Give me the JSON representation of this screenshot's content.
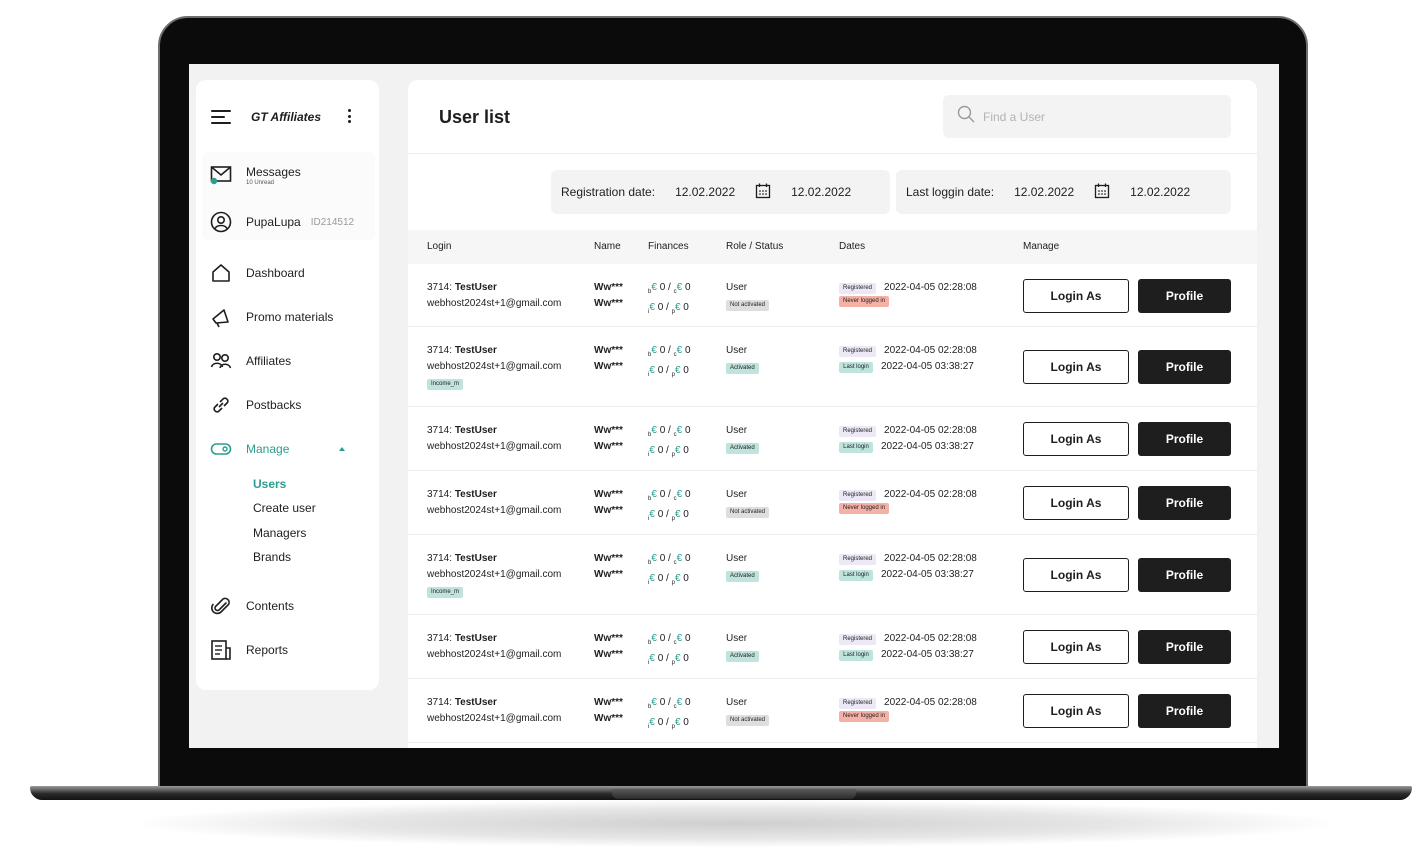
{
  "app": {
    "brand": "GT Affiliates"
  },
  "sidebar": {
    "messages": {
      "label": "Messages",
      "sub": "10 Unread"
    },
    "account": {
      "name": "PupaLupa",
      "id": "ID214512"
    },
    "nav": [
      {
        "label": "Dashboard",
        "icon": "home-icon"
      },
      {
        "label": "Promo materials",
        "icon": "megaphone-icon"
      },
      {
        "label": "Affiliates",
        "icon": "users-icon"
      },
      {
        "label": "Postbacks",
        "icon": "link-icon"
      },
      {
        "label": "Manage",
        "icon": "toggle-icon"
      },
      {
        "label": "Contents",
        "icon": "paperclip-icon"
      },
      {
        "label": "Reports",
        "icon": "report-icon"
      }
    ],
    "manage_sub": [
      "Users",
      "Create user",
      "Managers",
      "Brands"
    ]
  },
  "main": {
    "title": "User list",
    "search": {
      "placeholder": "Find a User"
    },
    "filters": {
      "registration": {
        "label": "Registration date:",
        "from": "12.02.2022",
        "to": "12.02.2022"
      },
      "last_login": {
        "label": "Last loggin date:",
        "from": "12.02.2022",
        "to": "12.02.2022"
      }
    },
    "columns": [
      "Login",
      "Name",
      "Finances",
      "Role / Status",
      "Dates",
      "Manage"
    ],
    "rows": [
      {
        "id": "3714: ",
        "login": "TestUser",
        "email": "webhost2024st+1@gmail.com",
        "tag": "",
        "name1": "Ww***",
        "name2": "Ww***",
        "role": "User",
        "status": "Not activated",
        "registered": "2022-04-05 02:28:08",
        "last": "Never logged in",
        "last_date": ""
      },
      {
        "id": "3714: ",
        "login": "TestUser",
        "email": "webhost2024st+1@gmail.com",
        "tag": "Income_m",
        "name1": "Ww***",
        "name2": "Ww***",
        "role": "User",
        "status": "Activated",
        "registered": "2022-04-05 02:28:08",
        "last": "Last login",
        "last_date": "2022-04-05 03:38:27"
      },
      {
        "id": "3714: ",
        "login": "TestUser",
        "email": "webhost2024st+1@gmail.com",
        "tag": "",
        "name1": "Ww***",
        "name2": "Ww***",
        "role": "User",
        "status": "Activated",
        "registered": "2022-04-05 02:28:08",
        "last": "Last login",
        "last_date": "2022-04-05 03:38:27"
      },
      {
        "id": "3714: ",
        "login": "TestUser",
        "email": "webhost2024st+1@gmail.com",
        "tag": "",
        "name1": "Ww***",
        "name2": "Ww***",
        "role": "User",
        "status": "Not activated",
        "registered": "2022-04-05 02:28:08",
        "last": "Never logged in",
        "last_date": ""
      },
      {
        "id": "3714: ",
        "login": "TestUser",
        "email": "webhost2024st+1@gmail.com",
        "tag": "Income_m",
        "name1": "Ww***",
        "name2": "Ww***",
        "role": "User",
        "status": "Activated",
        "registered": "2022-04-05 02:28:08",
        "last": "Last login",
        "last_date": "2022-04-05 03:38:27"
      },
      {
        "id": "3714: ",
        "login": "TestUser",
        "email": "webhost2024st+1@gmail.com",
        "tag": "",
        "name1": "Ww***",
        "name2": "Ww***",
        "role": "User",
        "status": "Activated",
        "registered": "2022-04-05 02:28:08",
        "last": "Last login",
        "last_date": "2022-04-05 03:38:27"
      },
      {
        "id": "3714: ",
        "login": "TestUser",
        "email": "webhost2024st+1@gmail.com",
        "tag": "",
        "name1": "Ww***",
        "name2": "Ww***",
        "role": "User",
        "status": "Not activated",
        "registered": "2022-04-05 02:28:08",
        "last": "Never logged in",
        "last_date": ""
      }
    ],
    "finances": {
      "sub_b": "b",
      "sub_c": "c",
      "sub_i": "i",
      "sub_p": "p",
      "currency": "€",
      "value": "0",
      "sep": "/"
    },
    "labels": {
      "registered": "Registered",
      "login_as": "Login As",
      "profile": "Profile"
    }
  },
  "colors": {
    "accent": "#2a9d8f",
    "dark": "#1e1e1e",
    "danger_tag": "#f6b1a6",
    "success_tag": "#bfe3dd"
  }
}
